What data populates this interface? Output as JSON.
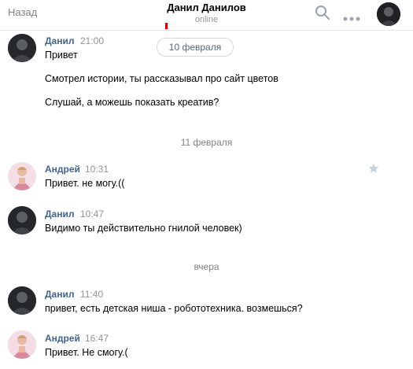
{
  "header": {
    "back_label": "Назад",
    "title": "Данил Данилов",
    "status": "online"
  },
  "date_pill": "10 февраля",
  "separators": [
    "11 февраля",
    "вчера"
  ],
  "messages": [
    {
      "author": "Данил",
      "time": "21:00",
      "lines": [
        "Привет",
        "Смотрел истории, ты рассказывал про сайт цветов",
        "Слушай, а можешь показать креатив?"
      ]
    },
    {
      "author": "Андрей",
      "time": "10:31",
      "lines": [
        "Привет. не могу.(("
      ]
    },
    {
      "author": "Данил",
      "time": "10:47",
      "lines": [
        "Видимо ты действительно гнилой человек)"
      ]
    },
    {
      "author": "Данил",
      "time": "11:40",
      "lines": [
        "привет, есть детская ниша - робототехника. возмешься?"
      ]
    },
    {
      "author": "Андрей",
      "time": "16:47",
      "lines": [
        "Привет. Не смогу.("
      ]
    }
  ],
  "icons": {
    "search": "search-icon",
    "more": "more-icon",
    "star": "star-icon"
  }
}
